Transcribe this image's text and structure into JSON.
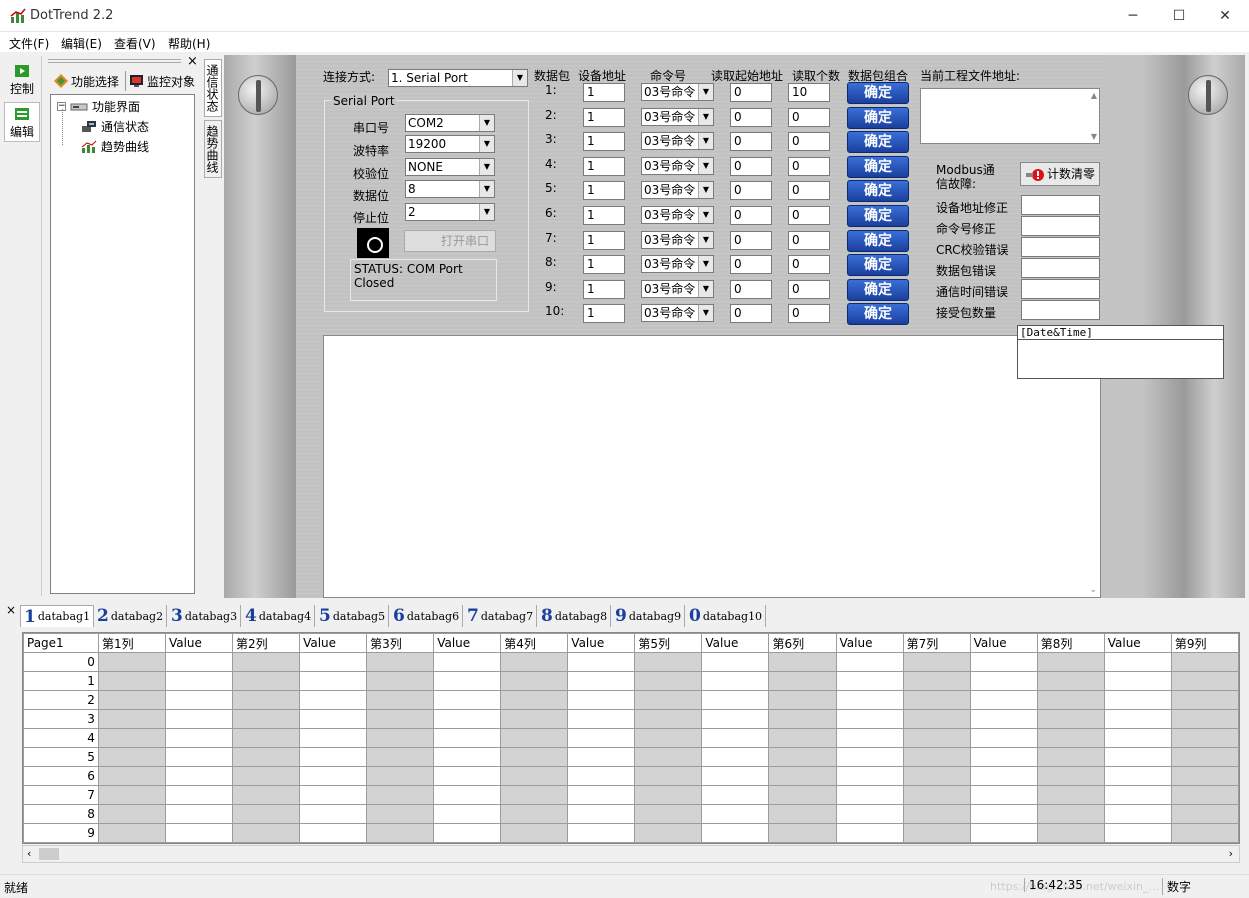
{
  "window": {
    "title": "DotTrend 2.2",
    "minimize": "─",
    "maximize": "☐",
    "close": "✕"
  },
  "menu": [
    "文件(F)",
    "编辑(E)",
    "查看(V)",
    "帮助(H)"
  ],
  "left_toolbar": [
    {
      "label": "控制"
    },
    {
      "label": "编辑"
    }
  ],
  "tree_panel": {
    "close": "×",
    "tabs": [
      "功能选择",
      "监控对象"
    ],
    "root": "功能界面",
    "children": [
      "通信状态",
      "趋势曲线"
    ]
  },
  "vertical_tabs": [
    "通信状态",
    "趋势曲线"
  ],
  "connection": {
    "label": "连接方式:",
    "value": "1. Serial Port"
  },
  "serial_port": {
    "group_title": "Serial Port",
    "fields": [
      {
        "label": "串口号",
        "value": "COM2"
      },
      {
        "label": "波特率",
        "value": "19200"
      },
      {
        "label": "校验位",
        "value": "NONE"
      },
      {
        "label": "数据位",
        "value": "8"
      },
      {
        "label": "停止位",
        "value": "2"
      }
    ],
    "open_button": "打开串口",
    "status": "STATUS:  COM Port Closed"
  },
  "packets": {
    "headers": [
      "数据包",
      "设备地址",
      "命令号",
      "读取起始地址",
      "读取个数",
      "数据包组合"
    ],
    "rows": [
      {
        "no": "1:",
        "addr": "1",
        "cmd": "03号命令",
        "start": "0",
        "count": "10",
        "btn": "确定"
      },
      {
        "no": "2:",
        "addr": "1",
        "cmd": "03号命令",
        "start": "0",
        "count": "0",
        "btn": "确定"
      },
      {
        "no": "3:",
        "addr": "1",
        "cmd": "03号命令",
        "start": "0",
        "count": "0",
        "btn": "确定"
      },
      {
        "no": "4:",
        "addr": "1",
        "cmd": "03号命令",
        "start": "0",
        "count": "0",
        "btn": "确定"
      },
      {
        "no": "5:",
        "addr": "1",
        "cmd": "03号命令",
        "start": "0",
        "count": "0",
        "btn": "确定"
      },
      {
        "no": "6:",
        "addr": "1",
        "cmd": "03号命令",
        "start": "0",
        "count": "0",
        "btn": "确定"
      },
      {
        "no": "7:",
        "addr": "1",
        "cmd": "03号命令",
        "start": "0",
        "count": "0",
        "btn": "确定"
      },
      {
        "no": "8:",
        "addr": "1",
        "cmd": "03号命令",
        "start": "0",
        "count": "0",
        "btn": "确定"
      },
      {
        "no": "9:",
        "addr": "1",
        "cmd": "03号命令",
        "start": "0",
        "count": "0",
        "btn": "确定"
      },
      {
        "no": "10:",
        "addr": "1",
        "cmd": "03号命令",
        "start": "0",
        "count": "0",
        "btn": "确定"
      }
    ]
  },
  "project": {
    "file_label": "当前工程文件地址:"
  },
  "modbus": {
    "fault_label": "Modbus通信故障:",
    "reset_button": "计数清零",
    "counters": [
      "设备地址修正",
      "命令号修正",
      "CRC校验错误",
      "数据包错误",
      "通信时间错误",
      "接受包数量"
    ]
  },
  "date_panel": {
    "header": "[Date&Time]"
  },
  "databag_tabs": [
    {
      "n": "1",
      "label": "databag1"
    },
    {
      "n": "2",
      "label": "databag2"
    },
    {
      "n": "3",
      "label": "databag3"
    },
    {
      "n": "4",
      "label": "databag4"
    },
    {
      "n": "5",
      "label": "databag5"
    },
    {
      "n": "6",
      "label": "databag6"
    },
    {
      "n": "7",
      "label": "databag7"
    },
    {
      "n": "8",
      "label": "databag8"
    },
    {
      "n": "9",
      "label": "databag9"
    },
    {
      "n": "0",
      "label": "databag10"
    }
  ],
  "grid": {
    "corner": "Page1",
    "columns": [
      "第1列",
      "Value",
      "第2列",
      "Value",
      "第3列",
      "Value",
      "第4列",
      "Value",
      "第5列",
      "Value",
      "第6列",
      "Value",
      "第7列",
      "Value",
      "第8列",
      "Value",
      "第9列"
    ],
    "rows": [
      "0",
      "1",
      "2",
      "3",
      "4",
      "5",
      "6",
      "7",
      "8",
      "9"
    ]
  },
  "statusbar": {
    "left": "就绪",
    "time": "16:42:35",
    "mode": "数字",
    "watermark": "https://blog.csdn.net/weixin_..."
  }
}
